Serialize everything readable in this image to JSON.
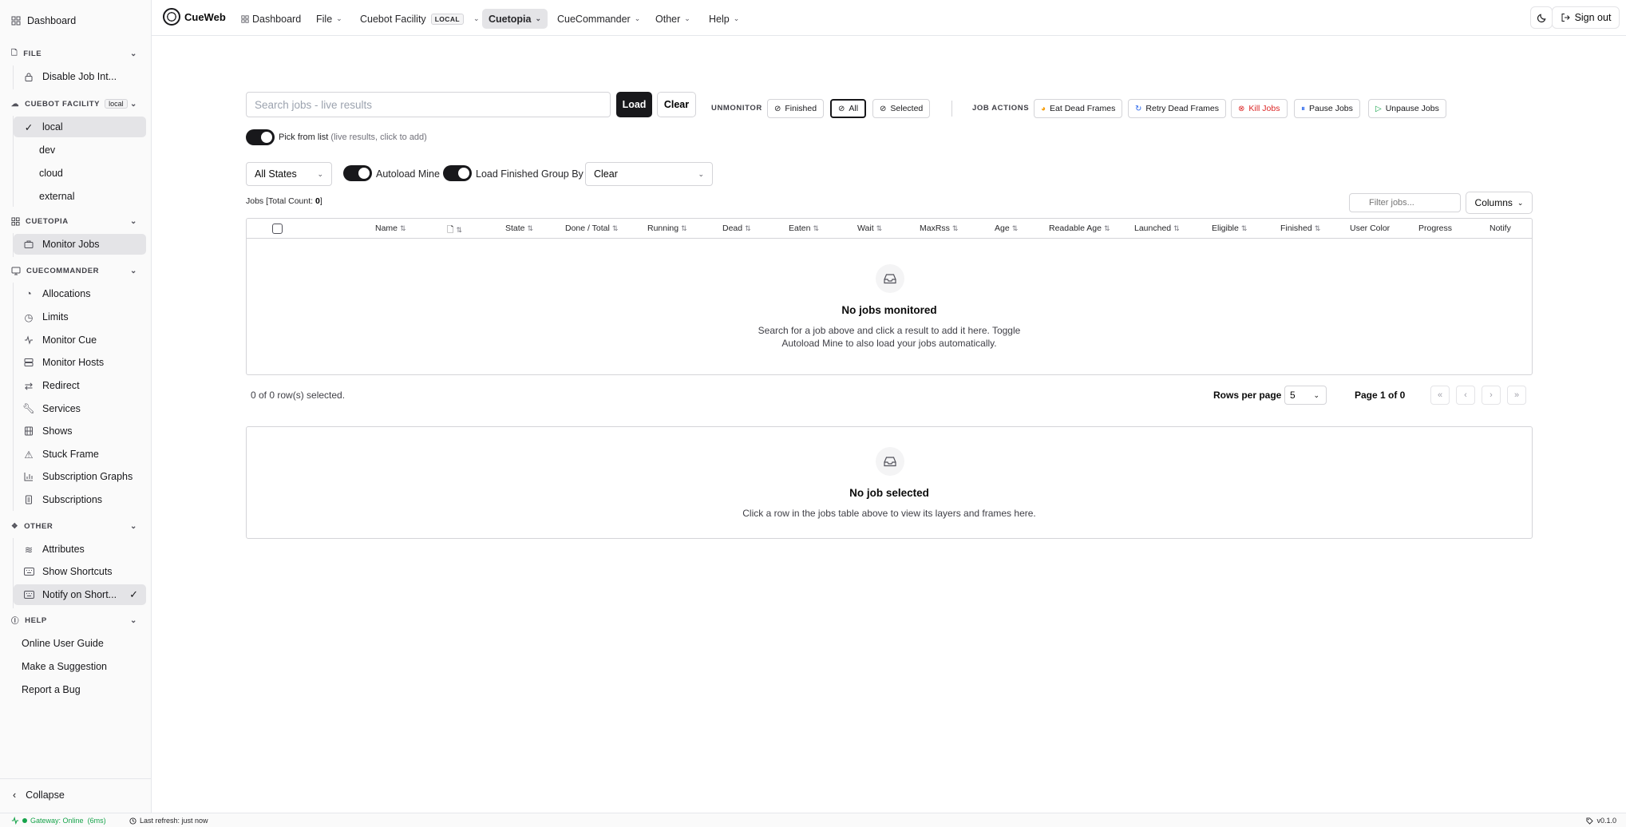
{
  "sidebar": {
    "dashboard": "Dashboard",
    "groups": {
      "file": "FILE",
      "cuebot_facility": "CUEBOT FACILITY",
      "cuebot_badge": "local",
      "cuetopia": "CUETOPIA",
      "cuecommander": "CUECOMMANDER",
      "other": "OTHER",
      "help": "HELP"
    },
    "file_items": [
      "Disable Job Int..."
    ],
    "facility_items": [
      "local",
      "dev",
      "cloud",
      "external"
    ],
    "cuetopia_items": [
      "Monitor Jobs"
    ],
    "cuecommander_items": [
      "Allocations",
      "Limits",
      "Monitor Cue",
      "Monitor Hosts",
      "Redirect",
      "Services",
      "Shows",
      "Stuck Frame",
      "Subscription Graphs",
      "Subscriptions"
    ],
    "other_items": [
      "Attributes",
      "Show Shortcuts",
      "Notify on Short..."
    ],
    "help_items": [
      "Online User Guide",
      "Make a Suggestion",
      "Report a Bug"
    ],
    "collapse": "Collapse"
  },
  "topnav": {
    "brand": "CueWeb",
    "dashboard": "Dashboard",
    "file": "File",
    "facility": "Cuebot Facility",
    "facility_badge": "LOCAL",
    "cuetopia": "Cuetopia",
    "cuecommander": "CueCommander",
    "other": "Other",
    "help": "Help",
    "signout": "Sign out"
  },
  "main": {
    "search_placeholder": "Search jobs - live results",
    "load": "Load",
    "clear": "Clear",
    "unmonitor_label": "UNMONITOR",
    "unmonitor": [
      "Finished",
      "All",
      "Selected"
    ],
    "job_actions_label": "JOB ACTIONS",
    "job_actions": [
      "Eat Dead Frames",
      "Retry Dead Frames",
      "Kill Jobs",
      "Pause Jobs",
      "Unpause Jobs"
    ],
    "pick_from_list": "Pick from list",
    "pick_hint": "(live results, click to add)",
    "state_select": "All States",
    "autoload_mine": "Autoload Mine",
    "load_finished": "Load Finished",
    "group_by": "Group By",
    "group_by_value": "Clear",
    "jobs_count_prefix": "Jobs [Total Count: ",
    "jobs_count": "0",
    "jobs_count_suffix": "]",
    "filter_placeholder": "Filter jobs...",
    "columns": "Columns",
    "table_headers": [
      "Name",
      "",
      "State",
      "Done / Total",
      "Running",
      "Dead",
      "Eaten",
      "Wait",
      "MaxRss",
      "Age",
      "Readable Age",
      "Launched",
      "Eligible",
      "Finished",
      "User Color",
      "Progress",
      "Notify"
    ],
    "empty_title": "No jobs monitored",
    "empty_text_1": "Search for a job above and click a result to add it here. Toggle",
    "empty_text_2": "Autoload Mine to also load your jobs automatically.",
    "selected_rows": "0 of 0 row(s) selected.",
    "rows_per_page": "Rows per page",
    "rows_per_page_value": "5",
    "page_info": "Page 1 of 0",
    "detail_title": "No job selected",
    "detail_text": "Click a row in the jobs table above to view its layers and frames here."
  },
  "status": {
    "gateway_label": "Gateway:",
    "gateway_state": "Online",
    "gateway_latency": "(6ms)",
    "last_refresh": "Last refresh: just now",
    "version": "v0.1.0"
  },
  "colors": {
    "accent": "#18181b",
    "online": "#16a34a",
    "danger": "#dc2626"
  }
}
